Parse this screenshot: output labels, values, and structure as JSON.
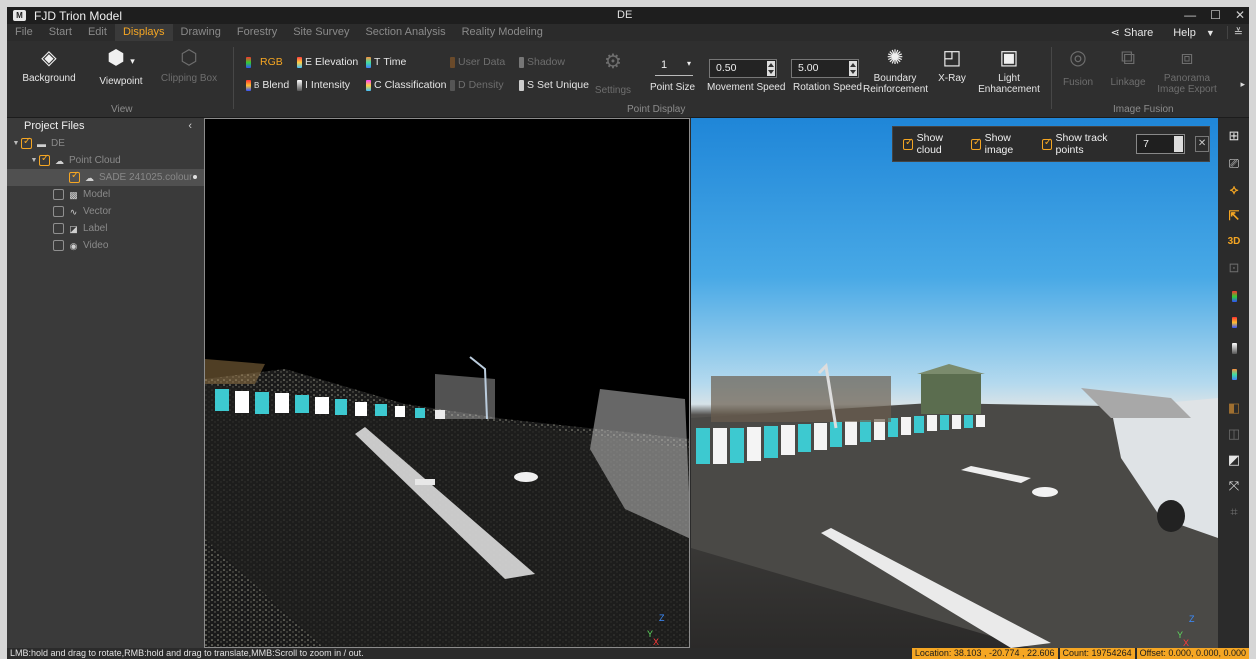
{
  "window": {
    "app_title": "FJD Trion Model",
    "doc_title": "DE",
    "controls": [
      "—",
      "☐",
      "✕"
    ]
  },
  "menu": {
    "items": [
      "File",
      "Start",
      "Edit",
      "Displays",
      "Drawing",
      "Forestry",
      "Site Survey",
      "Section Analysis",
      "Reality Modeling"
    ],
    "active": "Displays",
    "share_label": "Share",
    "help_label": "Help"
  },
  "ribbon": {
    "view_group": {
      "label": "View",
      "background": "Background",
      "viewpoint": "Viewpoint",
      "clipping_box": "Clipping Box"
    },
    "point_display_group": {
      "label": "Point Display",
      "rgb": "RGB",
      "elevation": "Elevation",
      "time": "Time",
      "user_data": "User Data",
      "shadow": "Shadow",
      "blend": "Blend",
      "intensity": "Intensity",
      "classification": "Classification",
      "density": "Density",
      "set_unique": "Set Unique",
      "settings": "Settings",
      "point_size_value": "1",
      "point_size_label": "Point Size",
      "movement_speed_value": "0.50",
      "movement_speed_label": "Movement Speed",
      "rotation_speed_value": "5.00",
      "rotation_speed_label": "Rotation Speed",
      "boundary_reinforcement": "Boundary Reinforcement",
      "xray": "X-Ray",
      "light_enhancement": "Light Enhancement"
    },
    "image_fusion_group": {
      "label": "Image Fusion",
      "fusion": "Fusion",
      "linkage": "Linkage",
      "panorama_export": "Panorama Image Export"
    }
  },
  "sidebar": {
    "title": "Project Files",
    "tree": [
      {
        "label": "DE"
      },
      {
        "label": "Point Cloud"
      },
      {
        "label": "SADE 241025.colour"
      },
      {
        "label": "Model"
      },
      {
        "label": "Vector"
      },
      {
        "label": "Label"
      },
      {
        "label": "Video"
      }
    ]
  },
  "image_view": {
    "show_cloud": "Show cloud",
    "show_image": "Show image",
    "show_track_points": "Show track points",
    "track_points_value": "7"
  },
  "axes": {
    "z": "Z",
    "y": "Y",
    "x": "X"
  },
  "right_toolbar": {
    "items": [
      "fit-view-icon",
      "camera-icon",
      "orbit-icon",
      "axis-icon",
      "3D",
      "lock-icon",
      "rgb-bar-icon",
      "blend-bar-icon",
      "intensity-bar-icon",
      "time-bar-icon",
      "box-icon-1",
      "box-icon-2",
      "box-icon-3",
      "link-icon",
      "crop-icon"
    ],
    "label_3d": "3D"
  },
  "status": {
    "hint": "LMB:hold and drag to rotate,RMB:hold and drag to translate,MMB:Scroll to zoom in / out.",
    "location": "Location: 38.103 , -20.774 , 22.606",
    "count": "Count: 19754264",
    "offset": "Offset: 0.000, 0.000, 0.000"
  },
  "colors": {
    "accent": "#f5a623",
    "background": "#2b2b2b",
    "panel": "#3a3a3a"
  }
}
